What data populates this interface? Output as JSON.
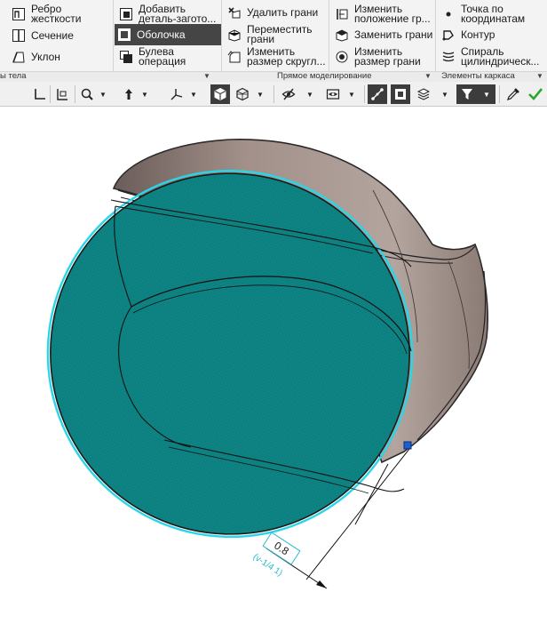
{
  "ribbon": {
    "col1": {
      "rib_label": "Ребро\nжесткости",
      "section_label": "Сечение",
      "draft_label": "Уклон"
    },
    "col2": {
      "add_blank_label": "Добавить\nдеталь-загото...",
      "shell_label": "Оболочка",
      "boolean_label": "Булева\nоперация"
    },
    "col3": {
      "delete_faces_label": "Удалить грани",
      "move_faces_label": "Переместить\nграни",
      "change_fillet_label": "Изменить\nразмер скругл..."
    },
    "col4": {
      "change_position_label": "Изменить\nположение гр...",
      "replace_faces_label": "Заменить грани",
      "change_size_label": "Изменить\nразмер грани"
    },
    "col5": {
      "point_by_coords_label": "Точка по\nкоординатам",
      "contour_label": "Контур",
      "cyl_spiral_label": "Спираль\nцилиндрическ..."
    },
    "groups": {
      "body_elements": "ы тела",
      "direct_modeling": "Прямое моделирование",
      "wireframe_elements": "Элементы каркаса"
    }
  },
  "colors": {
    "ribbon_bg": "#f3f3f3",
    "active_tool_bg": "#454545",
    "shell_face": "#0e8383",
    "selection_edge": "#29d5e6",
    "body_brown": "#9b8a85",
    "accept_green": "#2fa52f"
  },
  "icons": {
    "toolbar": [
      "corner-icon",
      "sketch-icon",
      "zoom-icon",
      "orient-icon",
      "axes-icon",
      "view-cube-icon",
      "display-mode-icon",
      "hide-icon",
      "visibility-icon",
      "vector-icon",
      "fill-icon",
      "layers-icon",
      "filter-icon",
      "eyedropper-icon",
      "checkmark-icon"
    ]
  },
  "dimension": {
    "value": "0.8",
    "tolerance": "(v-1/4 1)"
  }
}
